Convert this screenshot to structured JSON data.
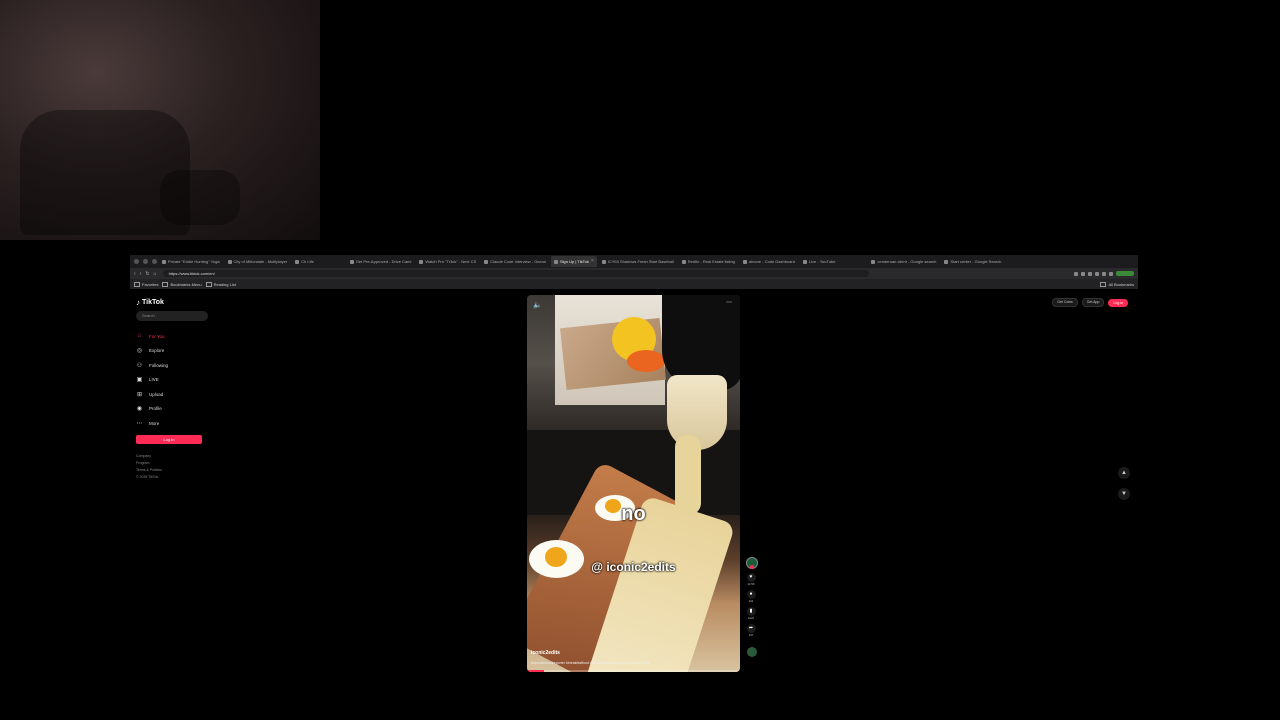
{
  "browser": {
    "tabs": [
      {
        "label": "Private \"Eddie Hunting\" Yoga"
      },
      {
        "label": "City of Miltondale - Multiplayer"
      },
      {
        "label": "Ch Life"
      },
      {
        "label": "Get Pre-Approved - Drive Cami"
      },
      {
        "label": "Watch Pro \"Tr3ck\" - Next CS"
      },
      {
        "label": "Claude Code Interview - Ocean"
      },
      {
        "label": "Sign Up | TikTok",
        "active": true
      },
      {
        "label": "ICYMI Shadows Fresh Start Baseball"
      },
      {
        "label": "Redfin - Real Estate listing"
      },
      {
        "label": "aircore - Code Dashboard"
      },
      {
        "label": "Live - YouTube"
      },
      {
        "label": "cenderoan client - Google search"
      },
      {
        "label": "Start center - Google Search"
      }
    ],
    "url": "https://www.tiktok.com/en/",
    "bookmarks": [
      "Favorites",
      "Bookmarks Menu",
      "Reading List"
    ],
    "bookmarks_right": "All Bookmarks"
  },
  "tiktok": {
    "logo": "TikTok",
    "search_placeholder": "Search",
    "nav": [
      {
        "label": "For You",
        "icon": "home-icon",
        "glyph": "⌂",
        "active": true
      },
      {
        "label": "Explore",
        "icon": "compass-icon",
        "glyph": "◎"
      },
      {
        "label": "Following",
        "icon": "following-icon",
        "glyph": "⚇"
      },
      {
        "label": "LIVE",
        "icon": "live-icon",
        "glyph": "▣"
      },
      {
        "label": "Upload",
        "icon": "upload-icon",
        "glyph": "⊞"
      },
      {
        "label": "Profile",
        "icon": "profile-icon",
        "glyph": "◉"
      },
      {
        "label": "More",
        "icon": "more-icon",
        "glyph": "⋯"
      }
    ],
    "login_label": "Log in",
    "footer": [
      "Company",
      "Program",
      "Terms & Policies",
      "© 2025 TikTok"
    ],
    "topright": {
      "get_coins": "Get Coins",
      "get_app": "Get App",
      "login": "Log in"
    },
    "video": {
      "caption_main": "no",
      "caption_handle": "@ iconic2edits",
      "username": "iconic2edits",
      "description": "#apocalicfoodreporter #breakfastfood #bisconedits #iconicfood #iconic2edits",
      "progress": 0.08
    },
    "actions": {
      "likes": "12.5K",
      "comments": "104",
      "saves": "2122",
      "shares": "197"
    }
  },
  "colors": {
    "accent": "#fe2c55",
    "background": "#000000"
  }
}
